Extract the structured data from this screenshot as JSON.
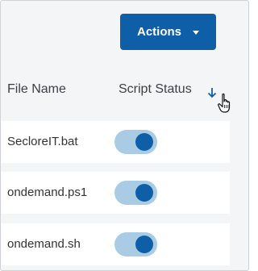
{
  "toolbar": {
    "actions_label": "Actions",
    "actions_icon": "caret-down-icon"
  },
  "table": {
    "columns": [
      "File Name",
      "Script Status"
    ],
    "sort": {
      "column": "Script Status",
      "direction": "descending",
      "icon": "arrow-down-icon"
    },
    "rows": [
      {
        "file_name": "SecloreIT.bat",
        "script_status": "on"
      },
      {
        "file_name": "ondemand.ps1",
        "script_status": "on"
      },
      {
        "file_name": "ondemand.sh",
        "script_status": "on"
      }
    ]
  },
  "cursor": {
    "icon": "hand-pointer-icon"
  },
  "colors": {
    "accent": "#0e5fa8",
    "toggle_track": "#a9cbe4",
    "background": "#f4f5f7",
    "row_background": "#ffffff"
  }
}
